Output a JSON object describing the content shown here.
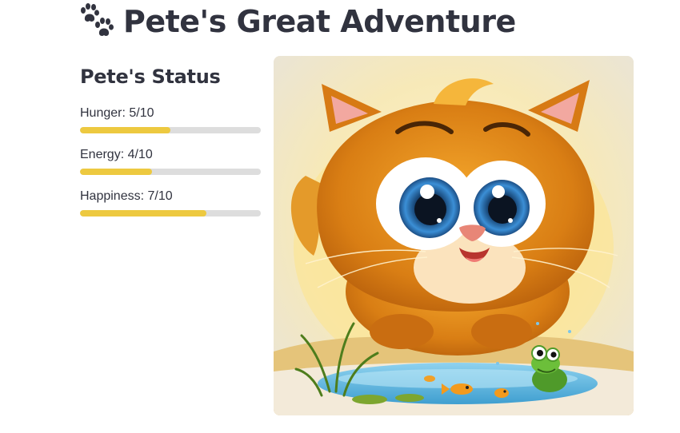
{
  "header": {
    "icon": "paw-prints-icon",
    "title": "Pete's Great Adventure"
  },
  "status": {
    "heading": "Pete's Status",
    "stats": [
      {
        "label": "Hunger: 5/10",
        "value": 5,
        "max": 10
      },
      {
        "label": "Energy: 4/10",
        "value": 4,
        "max": 10
      },
      {
        "label": "Happiness: 7/10",
        "value": 7,
        "max": 10
      }
    ]
  },
  "image": {
    "alt": "Cartoon orange cat with big blue eyes near a pond with a frog and goldfish"
  },
  "colors": {
    "progress_fill": "#edc940",
    "progress_track": "#dddddd",
    "text": "#31333f"
  }
}
